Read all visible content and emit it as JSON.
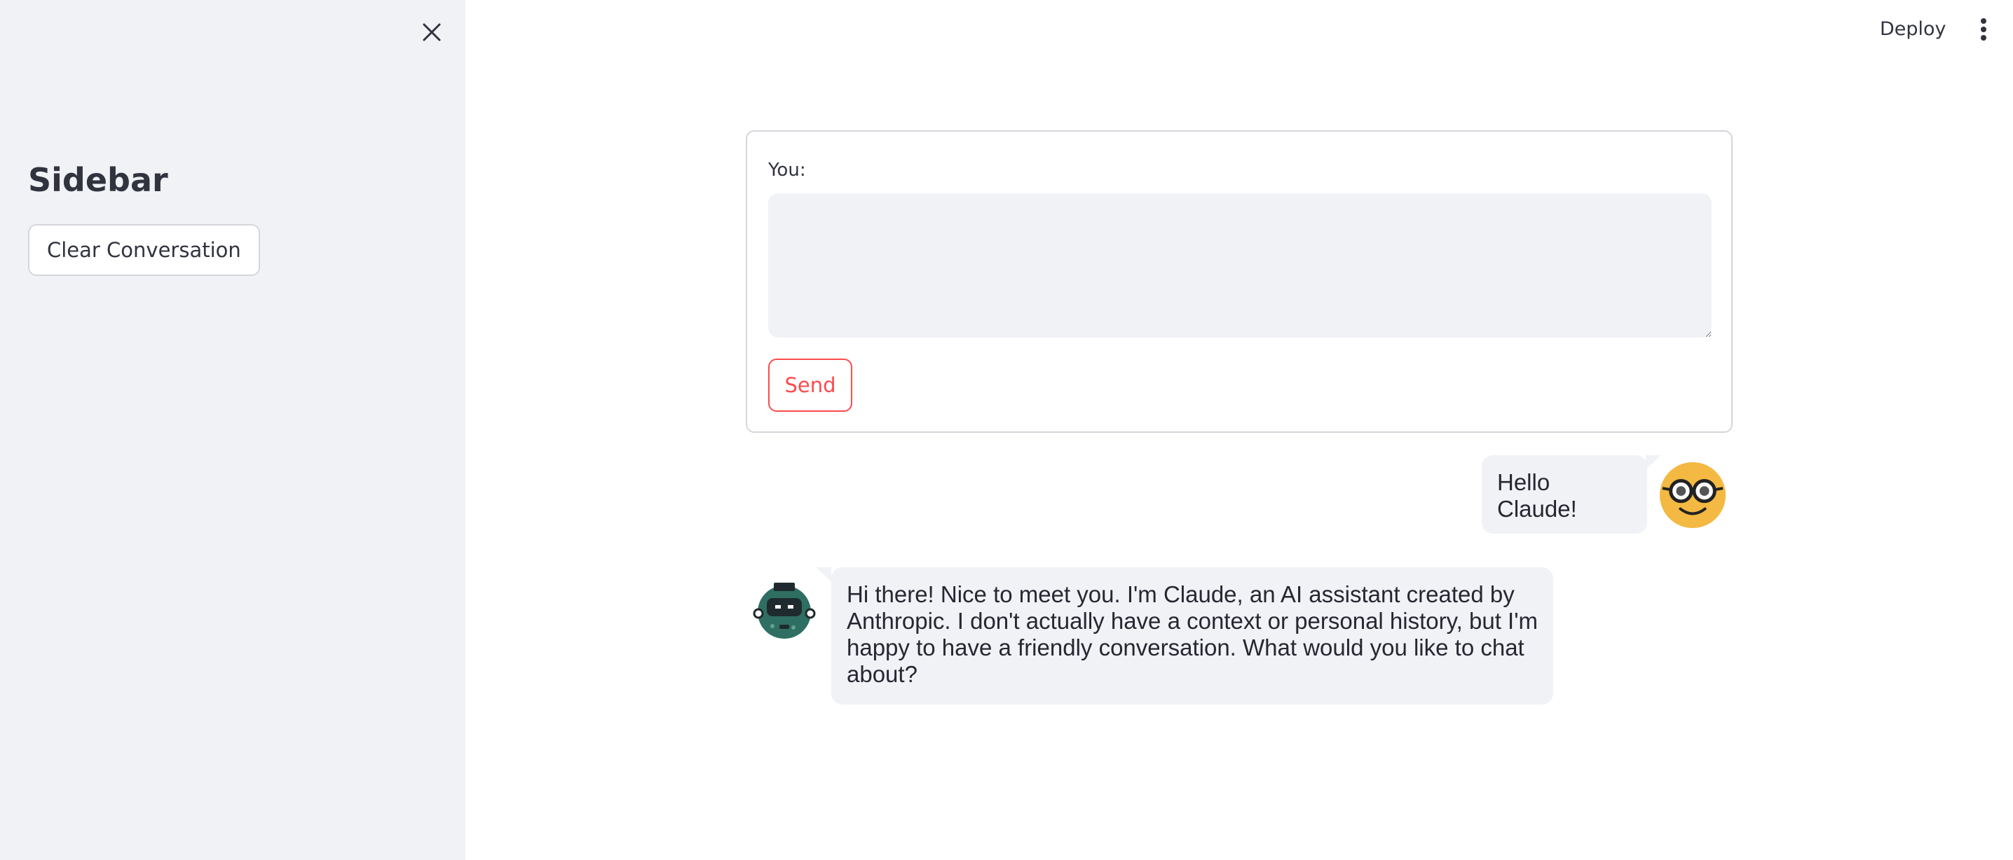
{
  "sidebar": {
    "title": "Sidebar",
    "clear_button_label": "Clear Conversation"
  },
  "header": {
    "deploy_label": "Deploy"
  },
  "form": {
    "input_label": "You:",
    "input_value": "",
    "send_label": "Send"
  },
  "messages": [
    {
      "role": "user",
      "text": "Hello Claude!"
    },
    {
      "role": "assistant",
      "text": "Hi there! Nice to meet you. I'm Claude, an AI assistant created by Anthropic. I don't actually have a context or personal history, but I'm happy to have a friendly conversation. What would you like to chat about?"
    }
  ],
  "colors": {
    "sidebar_bg": "#f0f2f6",
    "accent": "#ff4b4b",
    "bubble_bg": "#f0f2f6",
    "text": "#31333f",
    "user_avatar": "#f4b942",
    "bot_avatar": "#2f6e63"
  },
  "icons": {
    "close": "close-icon",
    "menu": "kebab-menu-icon",
    "user_avatar": "nerd-face-avatar-icon",
    "bot_avatar": "robot-avatar-icon"
  }
}
